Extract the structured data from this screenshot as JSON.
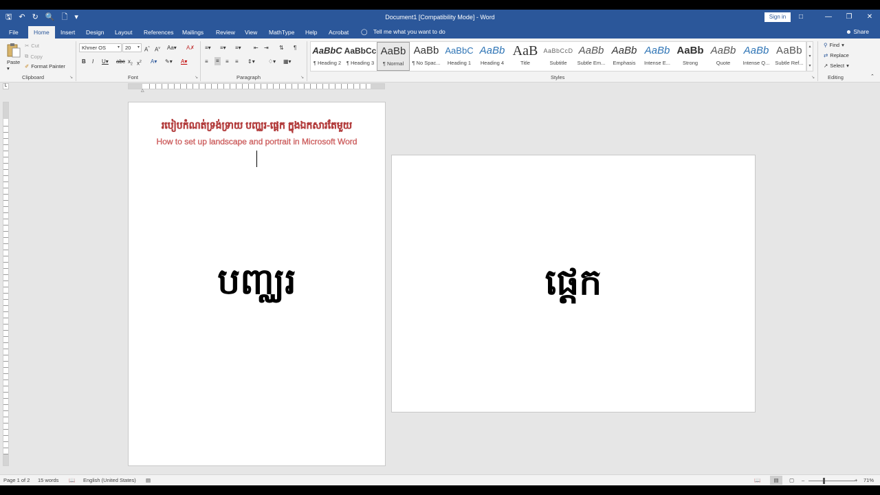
{
  "window": {
    "title": "Document1 [Compatibility Mode]  -  Word",
    "signin": "Sign in"
  },
  "tabs": [
    "File",
    "Home",
    "Insert",
    "Design",
    "Layout",
    "References",
    "Mailings",
    "Review",
    "View",
    "MathType",
    "Help",
    "Acrobat"
  ],
  "tell_me": "Tell me what you want to do",
  "share": "Share",
  "clipboard": {
    "paste": "Paste",
    "cut": "Cut",
    "copy": "Copy",
    "format_painter": "Format Painter",
    "label": "Clipboard"
  },
  "font": {
    "name": "Khmer OS",
    "size": "20",
    "label": "Font"
  },
  "paragraph": {
    "label": "Paragraph"
  },
  "styles": {
    "label": "Styles",
    "items": [
      {
        "sample": "AaBbC",
        "name": "¶ Heading 2"
      },
      {
        "sample": "AaBbCc",
        "name": "¶ Heading 3"
      },
      {
        "sample": "AaBb",
        "name": "¶ Normal"
      },
      {
        "sample": "AaBb",
        "name": "¶ No Spac..."
      },
      {
        "sample": "AaBbC",
        "name": "Heading 1"
      },
      {
        "sample": "AaBb",
        "name": "Heading 4"
      },
      {
        "sample": "AaB",
        "name": "Title"
      },
      {
        "sample": "AaBbCcD",
        "name": "Subtitle"
      },
      {
        "sample": "AaBb",
        "name": "Subtle Em..."
      },
      {
        "sample": "AaBb",
        "name": "Emphasis"
      },
      {
        "sample": "AaBb",
        "name": "Intense E..."
      },
      {
        "sample": "AaBb",
        "name": "Strong"
      },
      {
        "sample": "AaBb",
        "name": "Quote"
      },
      {
        "sample": "AaBb",
        "name": "Intense Q..."
      },
      {
        "sample": "AaBb",
        "name": "Subtle Ref..."
      }
    ]
  },
  "editing": {
    "label": "Editing",
    "find": "Find",
    "replace": "Replace",
    "select": "Select"
  },
  "document": {
    "title_khmer": "របៀបកំណត់ទ្រង់ទ្រាយ បញ្ឈរ-ផ្ដេក ក្នុងឯកសារតែមួយ",
    "title_english": "How to set up landscape and portrait in Microsoft Word",
    "portrait_word": "បញ្ឈរ",
    "landscape_word": "ផ្ដេក"
  },
  "status": {
    "page": "Page 1 of 2",
    "words": "15 words",
    "language": "English (United States)",
    "zoom": "71%"
  },
  "colors": {
    "accent": "#2b579a",
    "title_red": "#d86a6a"
  }
}
